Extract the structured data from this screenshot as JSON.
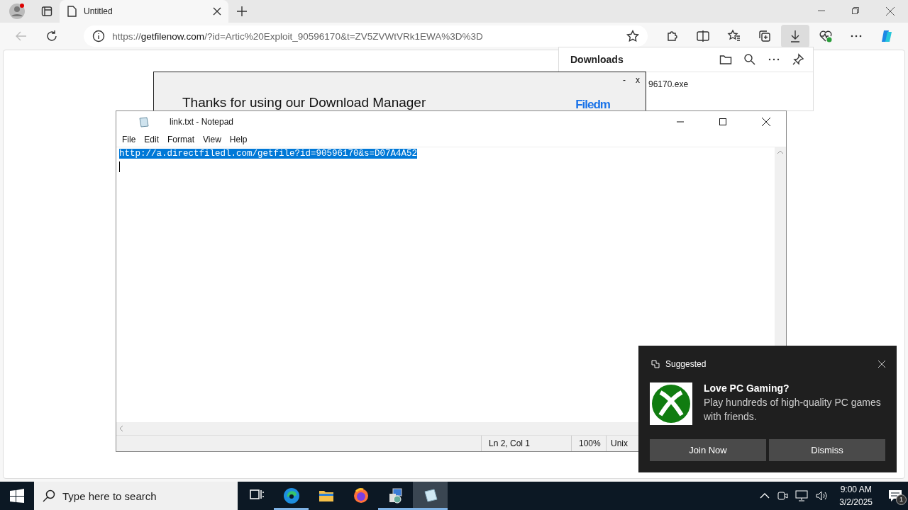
{
  "browser": {
    "tabs": [
      {
        "title": "Untitled",
        "selected": true
      }
    ],
    "url": {
      "scheme": "https://",
      "host": "getfilenow.com",
      "path": "/?id=Artic%20Exploit_90596170&t=ZV5ZVWtVRk1EWA%3D%3D"
    },
    "downloads_active": true
  },
  "downloads_panel": {
    "title": "Downloads",
    "items": [
      {
        "file": "96170.exe"
      }
    ]
  },
  "popup": {
    "heading": "Thanks for using our Download Manager",
    "logo": "Filedm",
    "buttons": [
      "-",
      "x"
    ]
  },
  "notepad": {
    "title": "link.txt - Notepad",
    "menu": [
      "File",
      "Edit",
      "Format",
      "View",
      "Help"
    ],
    "lines": [
      {
        "text": "http://a.directfiledl.com/getfile?id=90596170&s=D07A4A52",
        "selected": true
      }
    ],
    "status": [
      "Ln 2, Col 1",
      "100%",
      "Unix"
    ]
  },
  "toast": {
    "header": "Suggested",
    "title": "Love PC Gaming?",
    "body": "Play hundreds of high-quality PC games with friends.",
    "buttons": [
      "Join Now",
      "Dismiss"
    ]
  },
  "taskbar": {
    "search_placeholder": "Type here to search",
    "apps": [
      {
        "kind": "taskview",
        "running": false,
        "selected": false
      },
      {
        "kind": "edge",
        "running": true,
        "selected": false
      },
      {
        "kind": "explorer",
        "running": false,
        "selected": false
      },
      {
        "kind": "firefox",
        "running": false,
        "selected": false
      },
      {
        "kind": "installer",
        "running": true,
        "selected": false
      },
      {
        "kind": "notepad",
        "running": true,
        "selected": true
      }
    ],
    "time": "9:00 AM",
    "date": "3/2/2025",
    "notification_count": "1"
  }
}
